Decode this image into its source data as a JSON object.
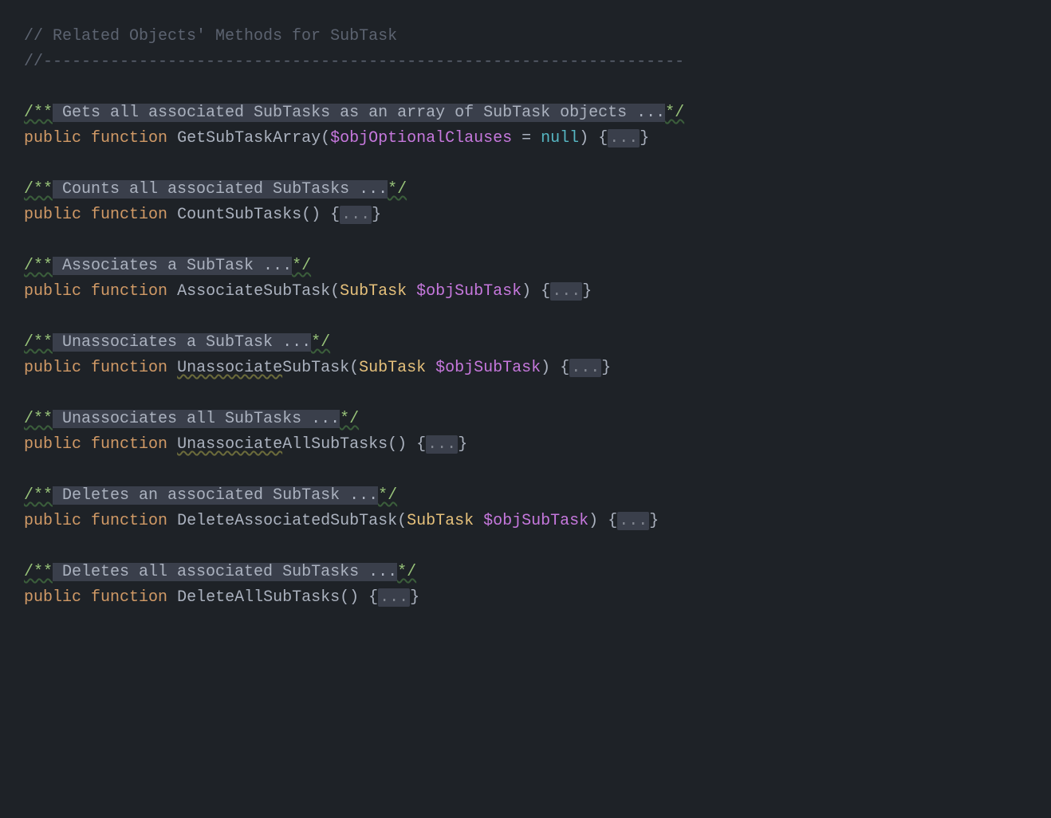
{
  "header": {
    "comment1": "// Related Objects' Methods for SubTask",
    "comment2": "//-------------------------------------------------------------------"
  },
  "methods": [
    {
      "doc_open": "/**",
      "doc_body": " Gets all associated SubTasks as an array of SubTask objects ...",
      "doc_close": "*/",
      "kw_vis": "public",
      "kw_fn": "function",
      "name": "GetSubTaskArray",
      "paren_open": "(",
      "param_var": "$objOptionalClauses",
      "assign": " = ",
      "param_val": "null",
      "paren_close": ")",
      "brace_open": " {",
      "fold": "...",
      "brace_close": "}"
    },
    {
      "doc_open": "/**",
      "doc_body": " Counts all associated SubTasks ...",
      "doc_close": "*/",
      "kw_vis": "public",
      "kw_fn": "function",
      "name": "CountSubTasks",
      "paren_open": "(",
      "paren_close": ")",
      "brace_open": " {",
      "fold": "...",
      "brace_close": "}"
    },
    {
      "doc_open": "/**",
      "doc_body": " Associates a SubTask ...",
      "doc_close": "*/",
      "kw_vis": "public",
      "kw_fn": "function",
      "name": "AssociateSubTask",
      "paren_open": "(",
      "param_type": "SubTask",
      "param_var": " $objSubTask",
      "paren_close": ")",
      "brace_open": " {",
      "fold": "...",
      "brace_close": "}"
    },
    {
      "doc_open": "/**",
      "doc_body": " Unassociates a SubTask ...",
      "doc_close": "*/",
      "kw_vis": "public",
      "kw_fn": "function",
      "name_pre": "Unassociate",
      "name_post": "SubTask",
      "paren_open": "(",
      "param_type": "SubTask",
      "param_var": " $objSubTask",
      "paren_close": ")",
      "brace_open": " {",
      "fold": "...",
      "brace_close": "}"
    },
    {
      "doc_open": "/**",
      "doc_body": " Unassociates all SubTasks ...",
      "doc_close": "*/",
      "kw_vis": "public",
      "kw_fn": "function",
      "name_pre": "Unassociate",
      "name_post": "AllSubTasks",
      "paren_open": "(",
      "paren_close": ")",
      "brace_open": " {",
      "fold": "...",
      "brace_close": "}"
    },
    {
      "doc_open": "/**",
      "doc_body": " Deletes an associated SubTask ...",
      "doc_close": "*/",
      "kw_vis": "public",
      "kw_fn": "function",
      "name": "DeleteAssociatedSubTask",
      "paren_open": "(",
      "param_type": "SubTask",
      "param_var": " $objSubTask",
      "paren_close": ")",
      "brace_open": " {",
      "fold": "...",
      "brace_close": "}"
    },
    {
      "doc_open": "/**",
      "doc_body": " Deletes all associated SubTasks ...",
      "doc_close": "*/",
      "kw_vis": "public",
      "kw_fn": "function",
      "name": "DeleteAllSubTasks",
      "paren_open": "(",
      "paren_close": ")",
      "brace_open": " {",
      "fold": "...",
      "brace_close": "}"
    }
  ]
}
